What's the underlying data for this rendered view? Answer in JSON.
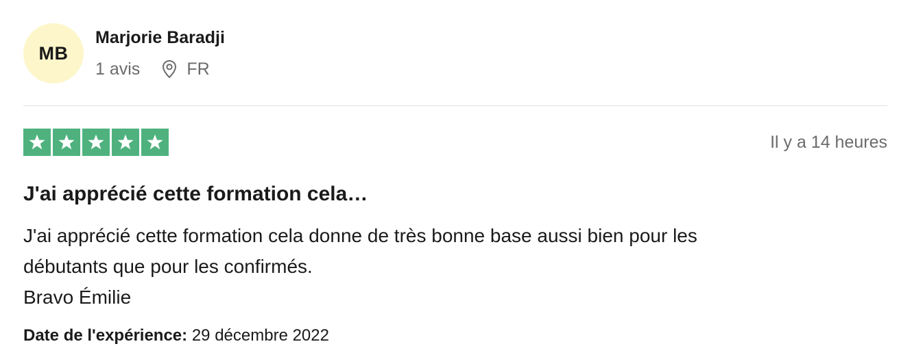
{
  "consumer": {
    "initials": "MB",
    "name": "Marjorie Baradji",
    "review_count": "1 avis",
    "country": "FR",
    "location_icon": "location-pin-icon"
  },
  "review": {
    "rating": 5,
    "rating_max": 5,
    "star_icon": "star-icon",
    "star_color": "#4fb27e",
    "posted": "Il y a 14 heures",
    "title": "J'ai apprécié cette formation cela…",
    "body_line1": "J'ai apprécié cette formation cela donne de très bonne base aussi bien pour les",
    "body_line2": "débutants que pour les confirmés.",
    "body_line3": "Bravo Émilie",
    "experience_label": "Date de l'expérience:",
    "experience_date": "29 décembre 2022"
  },
  "colors": {
    "avatar_bg": "#fcf6ca",
    "text": "#1a1a1a",
    "muted": "#6b6b6b",
    "divider": "#e1e1e1"
  }
}
